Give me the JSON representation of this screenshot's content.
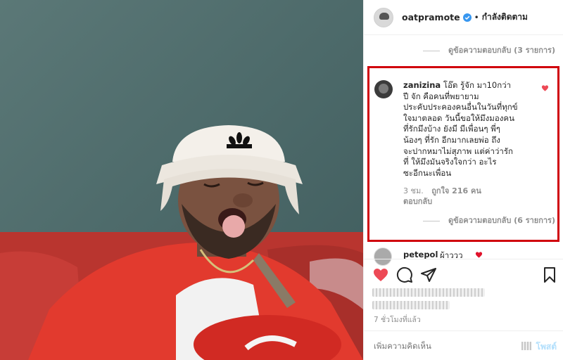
{
  "header": {
    "username": "oatpramote",
    "separator": "•",
    "follow_label": "กำลังติดตาม"
  },
  "replies_top": {
    "label": "ดูข้อความตอบกลับ (3 รายการ)"
  },
  "comment": {
    "username": "zanizina",
    "lines": [
      "โอ๊ต รู้จัก มา10กว่า",
      "ปี จัก คือคนที่พยายาม",
      "ประคับประคองคนอื่นในวันที่ทุกข์",
      "ใจมาตลอด วันนี้ขอให้มึงมองคน",
      "ที่รักมึงบ้าง ยังมี มีเพื่อนๆ พี่ๆ",
      "น้องๆ ที่รัก อีกมากเลยพ่อ ถึง",
      "จะปากหมาไม่สุภาพ แต่ค่าว่ารัก",
      "ที่ ให้มึงมันจริงใจกว่า อะไร",
      "ซะอีกนะเพื่อน"
    ],
    "time": "3 ชม.",
    "likes": "ถูกใจ 216 คน",
    "reply_label": "ตอบกลับ",
    "replies_label": "ดูข้อความตอบกลับ (6 รายการ)"
  },
  "next_comment": {
    "username": "petepol",
    "text": "ผ้าววว"
  },
  "post": {
    "time_ago": "7 ชั่วโมงที่แล้ว"
  },
  "comment_box": {
    "placeholder": "เพิ่มความคิดเห็น",
    "post_label": "โพสต์"
  },
  "colors": {
    "like_red": "#ed4956",
    "highlight_border": "#d0000b",
    "verified_blue": "#3897f0",
    "post_disabled": "#b2dffc"
  },
  "icons": [
    "verified-badge-icon",
    "heart-icon",
    "comment-icon",
    "share-icon",
    "bookmark-icon"
  ]
}
